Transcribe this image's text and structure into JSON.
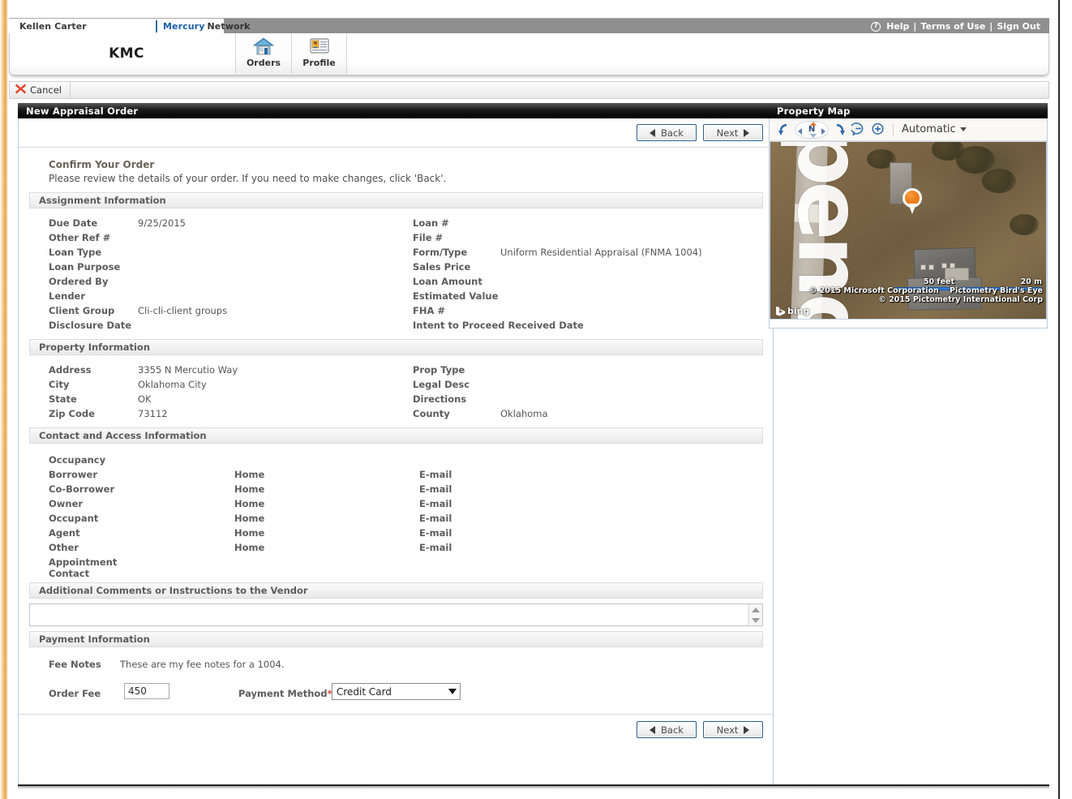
{
  "topbar": {
    "user": "Kellen Carter",
    "brand_primary": "Mercury",
    "brand_secondary": "Network",
    "help": "Help",
    "terms": "Terms of Use",
    "signout": "Sign Out",
    "pipe": "|"
  },
  "header": {
    "logo": "KMC",
    "tabs": [
      {
        "label": "Orders",
        "icon": "house-icon"
      },
      {
        "label": "Profile",
        "icon": "id-card-icon"
      }
    ]
  },
  "toolbar": {
    "cancel_label": "Cancel",
    "cancel_icon": "red-x-icon"
  },
  "main": {
    "panel_title": "New Appraisal Order",
    "back_label": "Back",
    "next_label": "Next",
    "confirm_title": "Confirm Your Order",
    "confirm_sub": "Please review the details of your order. If you need to make changes, click 'Back'.",
    "sections": {
      "assignment": {
        "title": "Assignment Information",
        "left": [
          {
            "label": "Due Date",
            "value": "9/25/2015"
          },
          {
            "label": "Other Ref #",
            "value": ""
          },
          {
            "label": "Loan Type",
            "value": ""
          },
          {
            "label": "Loan Purpose",
            "value": ""
          },
          {
            "label": "Ordered By",
            "value": ""
          },
          {
            "label": "Lender",
            "value": ""
          },
          {
            "label": "Client Group",
            "value": "Cli-cli-client groups"
          },
          {
            "label": "Disclosure Date",
            "value": ""
          }
        ],
        "right": [
          {
            "label": "Loan #",
            "value": ""
          },
          {
            "label": "File #",
            "value": ""
          },
          {
            "label": "Form/Type",
            "value": "Uniform Residential Appraisal (FNMA 1004)"
          },
          {
            "label": "Sales Price",
            "value": ""
          },
          {
            "label": "Loan Amount",
            "value": ""
          },
          {
            "label": "Estimated Value",
            "value": ""
          },
          {
            "label": "FHA #",
            "value": ""
          },
          {
            "label": "Intent to Proceed Received Date",
            "value": ""
          }
        ]
      },
      "property": {
        "title": "Property Information",
        "left": [
          {
            "label": "Address",
            "value": "3355 N Mercutio Way"
          },
          {
            "label": "City",
            "value": "Oklahoma City"
          },
          {
            "label": "State",
            "value": "OK"
          },
          {
            "label": "Zip Code",
            "value": "73112"
          }
        ],
        "right": [
          {
            "label": "Prop Type",
            "value": ""
          },
          {
            "label": "Legal Desc",
            "value": ""
          },
          {
            "label": "Directions",
            "value": ""
          },
          {
            "label": "County",
            "value": "Oklahoma"
          }
        ]
      },
      "contact": {
        "title": "Contact and Access Information",
        "occupancy_label": "Occupancy",
        "rows": [
          {
            "label": "Borrower",
            "home": "Home",
            "email": "E-mail"
          },
          {
            "label": "Co-Borrower",
            "home": "Home",
            "email": "E-mail"
          },
          {
            "label": "Owner",
            "home": "Home",
            "email": "E-mail"
          },
          {
            "label": "Occupant",
            "home": "Home",
            "email": "E-mail"
          },
          {
            "label": "Agent",
            "home": "Home",
            "email": "E-mail"
          },
          {
            "label": "Other",
            "home": "Home",
            "email": "E-mail"
          }
        ],
        "appointment_line1": "Appointment",
        "appointment_line2": "Contact"
      },
      "comments": {
        "title": "Additional Comments or Instructions to the Vendor",
        "value": "",
        "placeholder": ""
      },
      "payment": {
        "title": "Payment Information",
        "fee_notes_label": "Fee Notes",
        "fee_notes_value": "These are my fee notes for a 1004.",
        "order_fee_label": "Order Fee",
        "order_fee_value": "450",
        "payment_method_label": "Payment Method",
        "payment_method_required": "*",
        "payment_method_value": "Credit Card",
        "payment_method_options": [
          "Credit Card"
        ]
      }
    }
  },
  "map": {
    "panel_title": "Property Map",
    "toolbar": {
      "rotate_left_icon": "rotate-left-icon",
      "rotate_right_icon": "rotate-right-icon",
      "compass_label": "N",
      "zoom_out_icon": "zoom-out-icon",
      "zoom_in_icon": "zoom-in-icon",
      "mode_label": "Automatic"
    },
    "watermark_text": "pend",
    "scale_feet": "50 feet",
    "scale_meters": "20 m",
    "attribution_line1": "© 2015 Microsoft Corporation",
    "attribution_line2": "Pictometry Bird's Eye",
    "attribution_line3": "© 2015 Pictometry International Corp",
    "provider": "bing"
  },
  "colors": {
    "accent_blue": "#1a5fa8",
    "pin_orange": "#ef7f1c",
    "required_red": "#d8412f",
    "panel_border": "#b9cde0"
  }
}
